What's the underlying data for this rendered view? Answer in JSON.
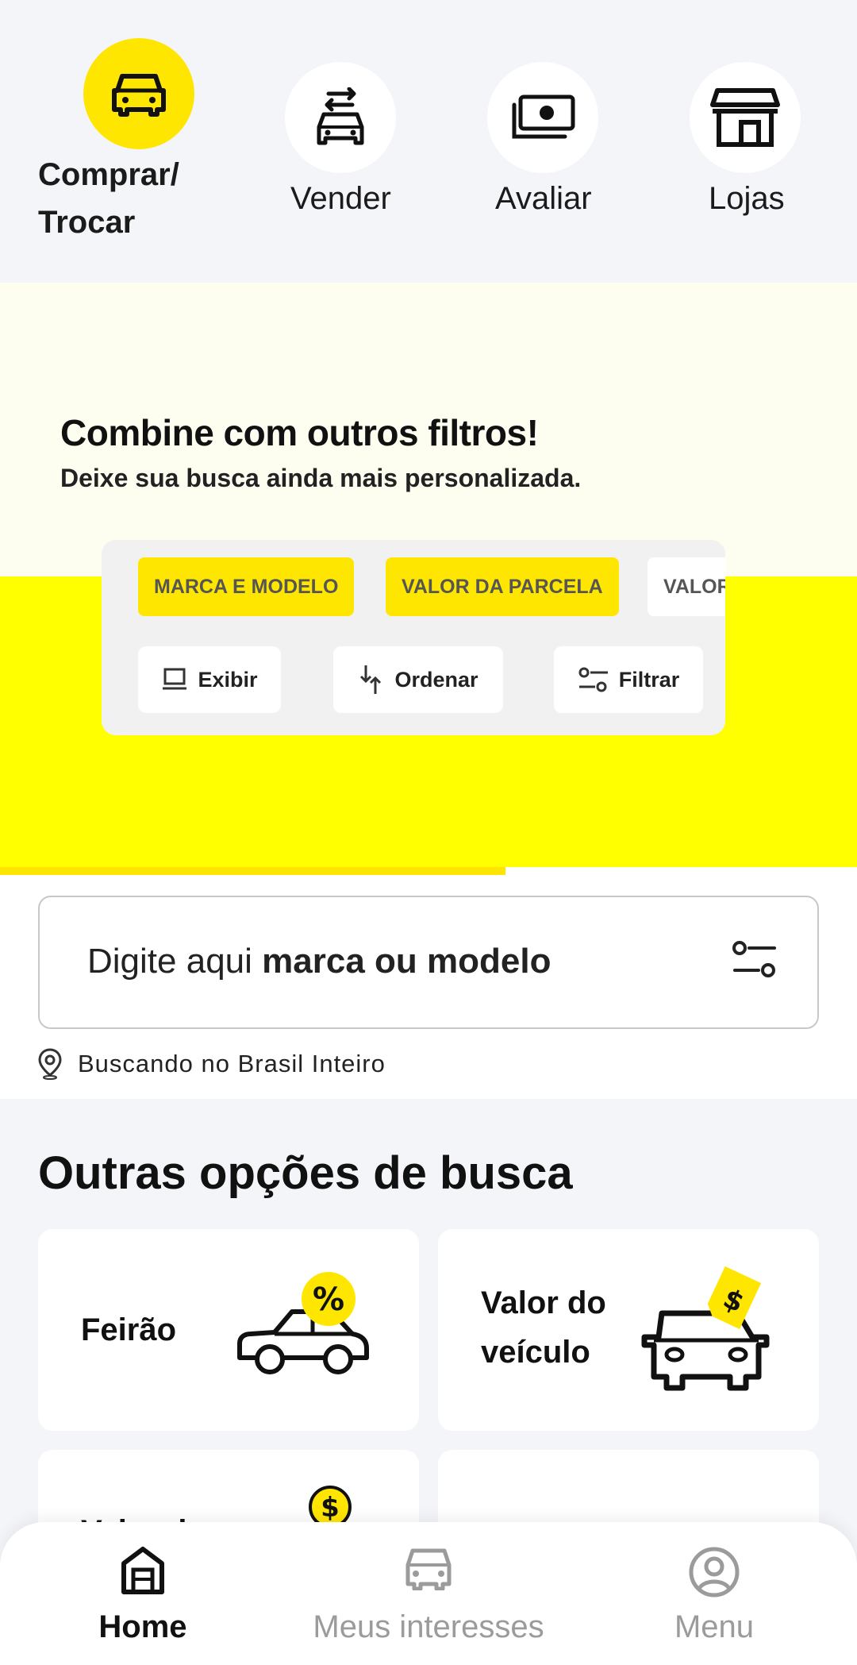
{
  "top_nav": {
    "items": [
      {
        "label": "Comprar/ Trocar",
        "line1": "Comprar/",
        "line2": "Trocar",
        "icon": "car-front-icon",
        "active": true
      },
      {
        "label": "Vender",
        "icon": "car-exchange-icon",
        "active": false
      },
      {
        "label": "Avaliar",
        "icon": "money-icon",
        "active": false
      },
      {
        "label": "Lojas",
        "icon": "store-icon",
        "active": false
      }
    ]
  },
  "banner": {
    "title": "Combine com outros filtros!",
    "subtitle": "Deixe sua busca ainda mais personalizada.",
    "chips": [
      "MARCA E MODELO",
      "VALOR DA PARCELA",
      "VALOR"
    ],
    "buttons": [
      "Exibir",
      "Ordenar",
      "Filtrar"
    ],
    "carousel_progress": 0.59,
    "colors": {
      "yellow": "#ffff00",
      "brand_yellow": "#ffe600"
    }
  },
  "search": {
    "prefix": "Digite aqui ",
    "emphasis": "marca ou modelo",
    "location_text": "Buscando no Brasil Inteiro"
  },
  "other_options": {
    "title": "Outras opções de busca",
    "cards": [
      {
        "label": "Feirão",
        "icon": "car-discount-icon"
      },
      {
        "label": "Valor do veículo",
        "line1": "Valor do",
        "line2": "veículo",
        "icon": "car-price-tag-icon"
      },
      {
        "label": "Valor d",
        "icon": "dollar-coin-icon"
      },
      {
        "label": "",
        "icon": ""
      }
    ]
  },
  "bottom_nav": {
    "items": [
      {
        "label": "Home",
        "icon": "home-icon",
        "active": true
      },
      {
        "label": "Meus interesses",
        "icon": "car-icon",
        "active": false
      },
      {
        "label": "Menu",
        "icon": "user-circle-icon",
        "active": false
      }
    ]
  }
}
